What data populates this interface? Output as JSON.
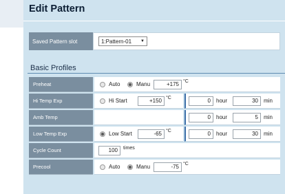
{
  "title": "Edit Pattern",
  "saved_pattern": {
    "label": "Saved Pattern slot",
    "value": "1:Pattern-01"
  },
  "section_title": "Basic Profiles",
  "units": {
    "temp": "°C",
    "hour": "hour",
    "min": "min",
    "times": "times"
  },
  "rows": {
    "preheat": {
      "label": "Preheat",
      "opt_auto": "Auto",
      "opt_manu": "Manu",
      "selected": "Manu",
      "value": "+175"
    },
    "hi_temp_exp": {
      "label": "Hi Temp Exp",
      "opt": "Hi Start",
      "selected": false,
      "value": "+150",
      "hour": "0",
      "min": "30"
    },
    "amb_temp": {
      "label": "Amb Temp",
      "hour": "0",
      "min": "5"
    },
    "low_temp_exp": {
      "label": "Low Temp Exp",
      "opt": "Low Start",
      "selected": true,
      "value": "-65",
      "hour": "0",
      "min": "30"
    },
    "cycle_count": {
      "label": "Cycle Count",
      "value": "100"
    },
    "precool": {
      "label": "Precool",
      "opt_auto": "Auto",
      "opt_manu": "Manu",
      "selected": "Manu",
      "value": "-75"
    }
  }
}
